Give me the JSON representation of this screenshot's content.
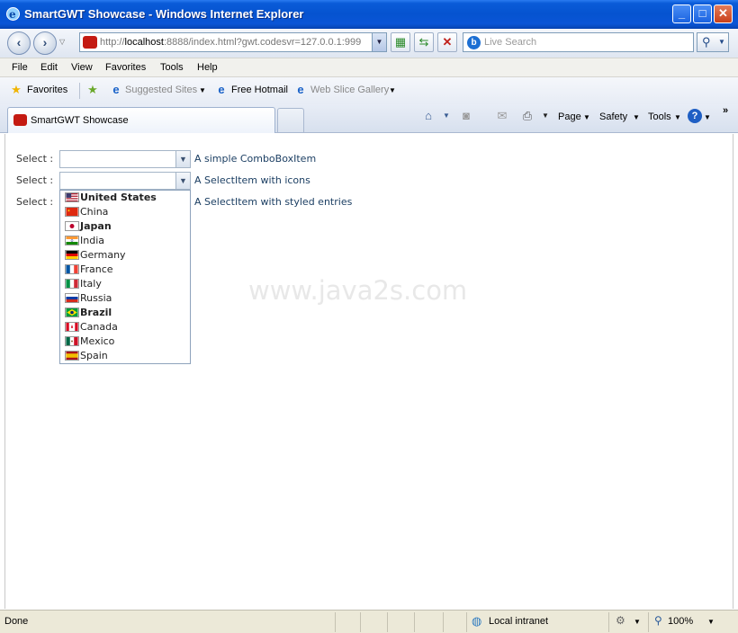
{
  "window": {
    "title": "SmartGWT Showcase - Windows Internet Explorer",
    "minimize": "_",
    "maximize": "□",
    "close": "✕"
  },
  "address": {
    "url_prefix": "http://",
    "url_host": "localhost",
    "url_rest": ":8888/index.html?gwt.codesvr=127.0.0.1:999"
  },
  "search": {
    "placeholder": "Live Search"
  },
  "menu": {
    "items": [
      "File",
      "Edit",
      "View",
      "Favorites",
      "Tools",
      "Help"
    ]
  },
  "favorites": {
    "favorites_label": "Favorites",
    "suggested_sites": "Suggested Sites",
    "free_hotmail": "Free Hotmail",
    "web_slice_gallery": "Web Slice Gallery"
  },
  "tabs": {
    "active_label": "SmartGWT Showcase"
  },
  "commands": {
    "page": "Page",
    "safety": "Safety",
    "tools": "Tools",
    "more": "»"
  },
  "form": {
    "rows": [
      {
        "label": "Select :",
        "description": "A simple ComboBoxItem"
      },
      {
        "label": "Select :",
        "description": "A SelectItem with icons"
      },
      {
        "label": "Select :",
        "description": "A SelectItem with styled entries"
      }
    ],
    "picklist": [
      {
        "name": "United States",
        "bold": true,
        "flag": "us-flag-icon"
      },
      {
        "name": "China",
        "bold": false,
        "flag": "china-flag-icon"
      },
      {
        "name": "Japan",
        "bold": true,
        "flag": "japan-flag-icon"
      },
      {
        "name": "India",
        "bold": false,
        "flag": "india-flag-icon"
      },
      {
        "name": "Germany",
        "bold": false,
        "flag": "germany-flag-icon"
      },
      {
        "name": "France",
        "bold": false,
        "flag": "france-flag-icon"
      },
      {
        "name": "Italy",
        "bold": false,
        "flag": "italy-flag-icon"
      },
      {
        "name": "Russia",
        "bold": false,
        "flag": "russia-flag-icon"
      },
      {
        "name": "Brazil",
        "bold": true,
        "flag": "brazil-flag-icon"
      },
      {
        "name": "Canada",
        "bold": false,
        "flag": "canada-flag-icon"
      },
      {
        "name": "Mexico",
        "bold": false,
        "flag": "mexico-flag-icon"
      },
      {
        "name": "Spain",
        "bold": false,
        "flag": "spain-flag-icon"
      }
    ]
  },
  "watermark": "www.java2s.com",
  "status": {
    "text": "Done",
    "zone": "Local intranet",
    "zoom": "100%"
  }
}
